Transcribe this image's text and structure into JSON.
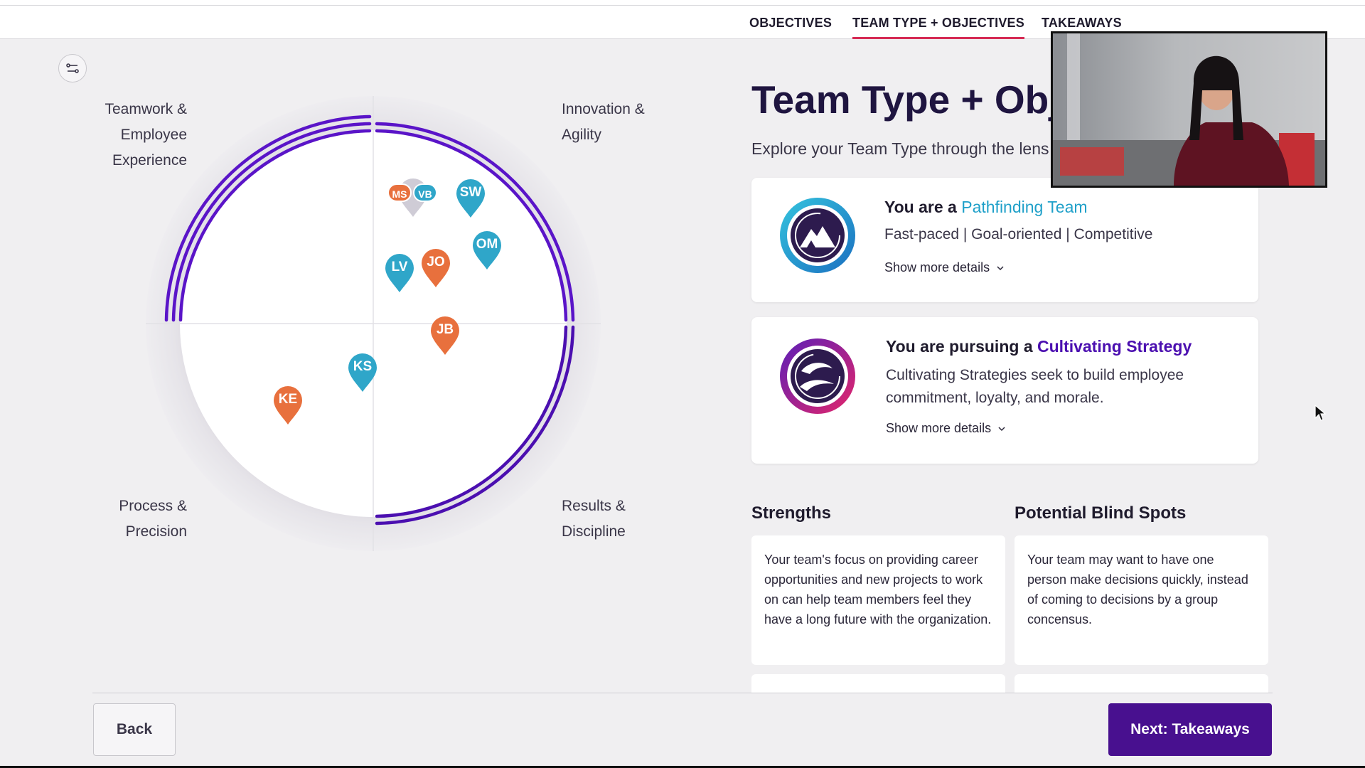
{
  "nav": {
    "tabs": [
      {
        "label": "OBJECTIVES",
        "active": false
      },
      {
        "label": "TEAM TYPE + OBJECTIVES",
        "active": true
      },
      {
        "label": "TAKEAWAYS",
        "active": false
      }
    ]
  },
  "quadrants": {
    "top_left": [
      "Teamwork &",
      "Employee",
      "Experience"
    ],
    "top_right": [
      "Innovation &",
      "Agility"
    ],
    "bottom_left": [
      "Process &",
      "Precision"
    ],
    "bottom_right": [
      "Results &",
      "Discipline"
    ]
  },
  "map": {
    "ring_color": "#5a14c8",
    "members": [
      {
        "initials": "SW",
        "color": "#2fa6c9"
      },
      {
        "initials": "OM",
        "color": "#2fa6c9"
      },
      {
        "initials": "LV",
        "color": "#2fa6c9"
      },
      {
        "initials": "JO",
        "color": "#e8703d"
      },
      {
        "initials": "JB",
        "color": "#e8703d"
      },
      {
        "initials": "KS",
        "color": "#2fa6c9"
      },
      {
        "initials": "KE",
        "color": "#e8703d"
      }
    ],
    "cluster": [
      {
        "initials": "MS",
        "color": "#e8703d"
      },
      {
        "initials": "VB",
        "color": "#2fa6c9"
      }
    ]
  },
  "main": {
    "title": "Team Type + Obje",
    "subtitle": "Explore your Team Type through the lens"
  },
  "team_card": {
    "prefix": "You are a ",
    "team": "Pathfinding Team",
    "tags": "Fast-paced  |  Goal-oriented  |  Competitive",
    "more": "Show more details"
  },
  "strategy_card": {
    "prefix": "You are pursuing a ",
    "strategy": "Cultivating Strategy",
    "description": "Cultivating Strategies seek to build employee commitment, loyalty, and morale.",
    "more": "Show more details"
  },
  "strengths": {
    "heading": "Strengths",
    "text": "Your team's focus on providing career opportunities and new projects to work on can help team members feel they have a long future with the organization."
  },
  "blind_spots": {
    "heading": "Potential Blind Spots",
    "text": "Your team may want to have one person make decisions quickly, instead of coming to decisions by a group concensus."
  },
  "footer": {
    "back": "Back",
    "next": "Next: Takeaways"
  },
  "colors": {
    "accent_red": "#d62b55",
    "primary_purple": "#48108f",
    "teal": "#1fa0c9"
  }
}
